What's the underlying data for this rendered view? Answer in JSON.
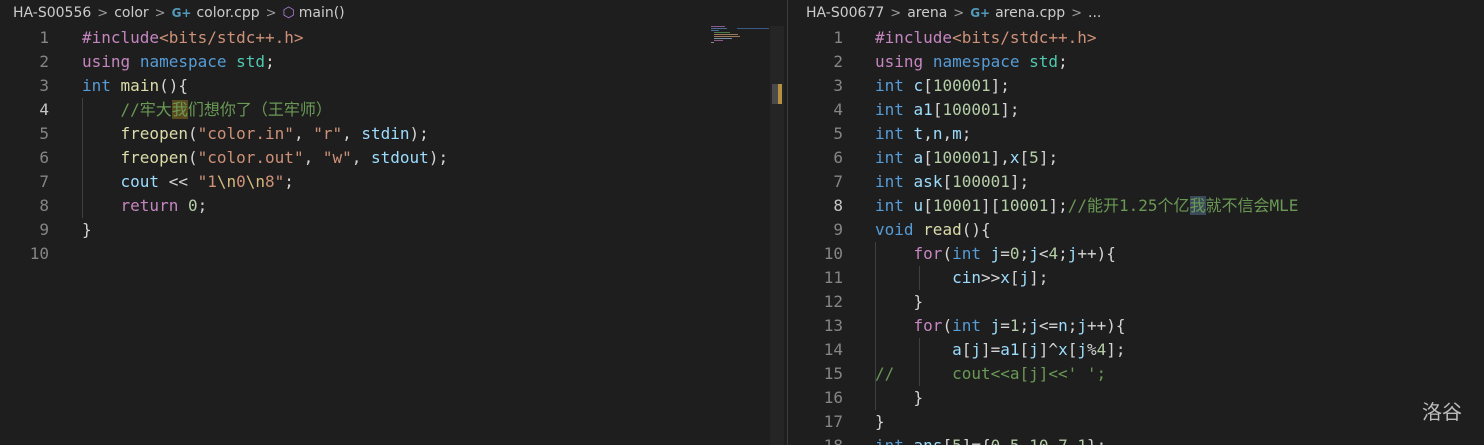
{
  "left": {
    "breadcrumb": [
      "HA-S00556",
      "color",
      "color.cpp",
      "main()"
    ],
    "file_icon": "C++",
    "active_line": 4,
    "line_numbers": [
      "1",
      "2",
      "3",
      "4",
      "5",
      "6",
      "7",
      "8",
      "9",
      "10"
    ]
  },
  "right": {
    "breadcrumb": [
      "HA-S00677",
      "arena",
      "arena.cpp",
      "..."
    ],
    "file_icon": "C++",
    "active_line": 8,
    "line_numbers": [
      "1",
      "2",
      "3",
      "4",
      "5",
      "6",
      "7",
      "8",
      "9",
      "10",
      "11",
      "12",
      "13",
      "14",
      "15",
      "16",
      "17",
      "18"
    ]
  },
  "watermark": "洛谷",
  "colors": {
    "background": "#1e1e1e",
    "keyword": "#569cd6",
    "preprocessor": "#c586c0",
    "string": "#ce9178",
    "comment": "#6a9955",
    "function": "#dcdcaa",
    "variable": "#9cdcfe",
    "number": "#b5cea8"
  }
}
